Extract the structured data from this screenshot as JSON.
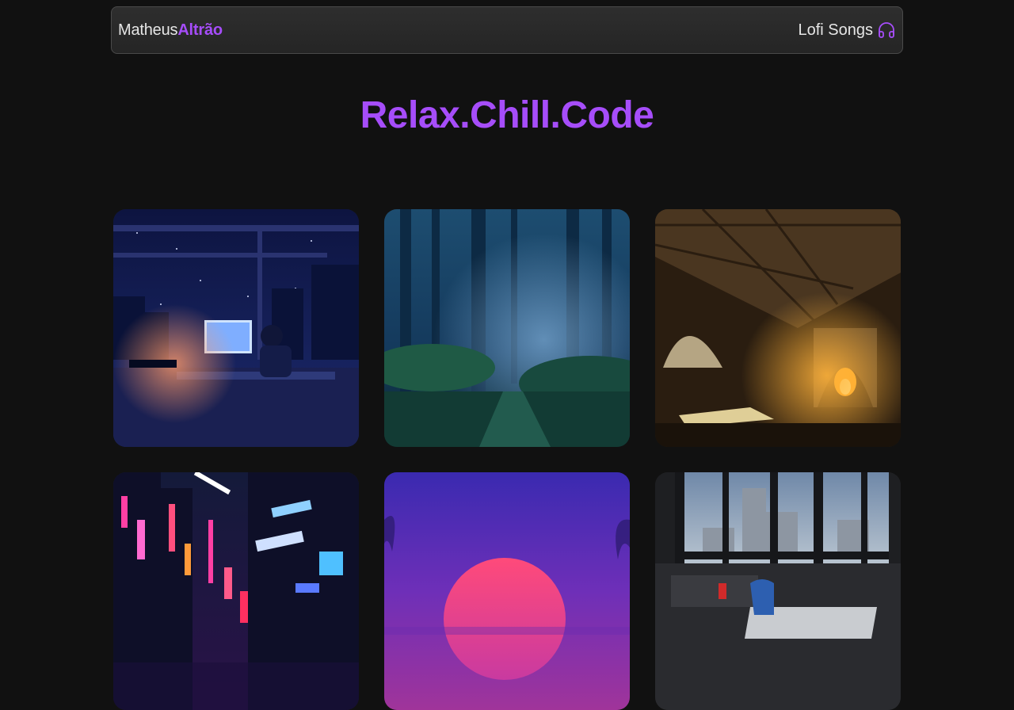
{
  "header": {
    "brand_first": "Matheus",
    "brand_last": "Altrão",
    "nav_link": "Lofi Songs",
    "nav_icon": "headphones-icon"
  },
  "hero": {
    "title": "Relax.Chill.Code"
  },
  "colors": {
    "accent": "#a64dfa",
    "background": "#111111",
    "navbar_border": "#4a4a4a"
  },
  "cards": [
    {
      "scene": "night-room-desk-window"
    },
    {
      "scene": "misty-blue-forest"
    },
    {
      "scene": "cozy-cabin-fireplace"
    },
    {
      "scene": "neon-city-street"
    },
    {
      "scene": "synthwave-sunset"
    },
    {
      "scene": "urban-office-window"
    }
  ]
}
